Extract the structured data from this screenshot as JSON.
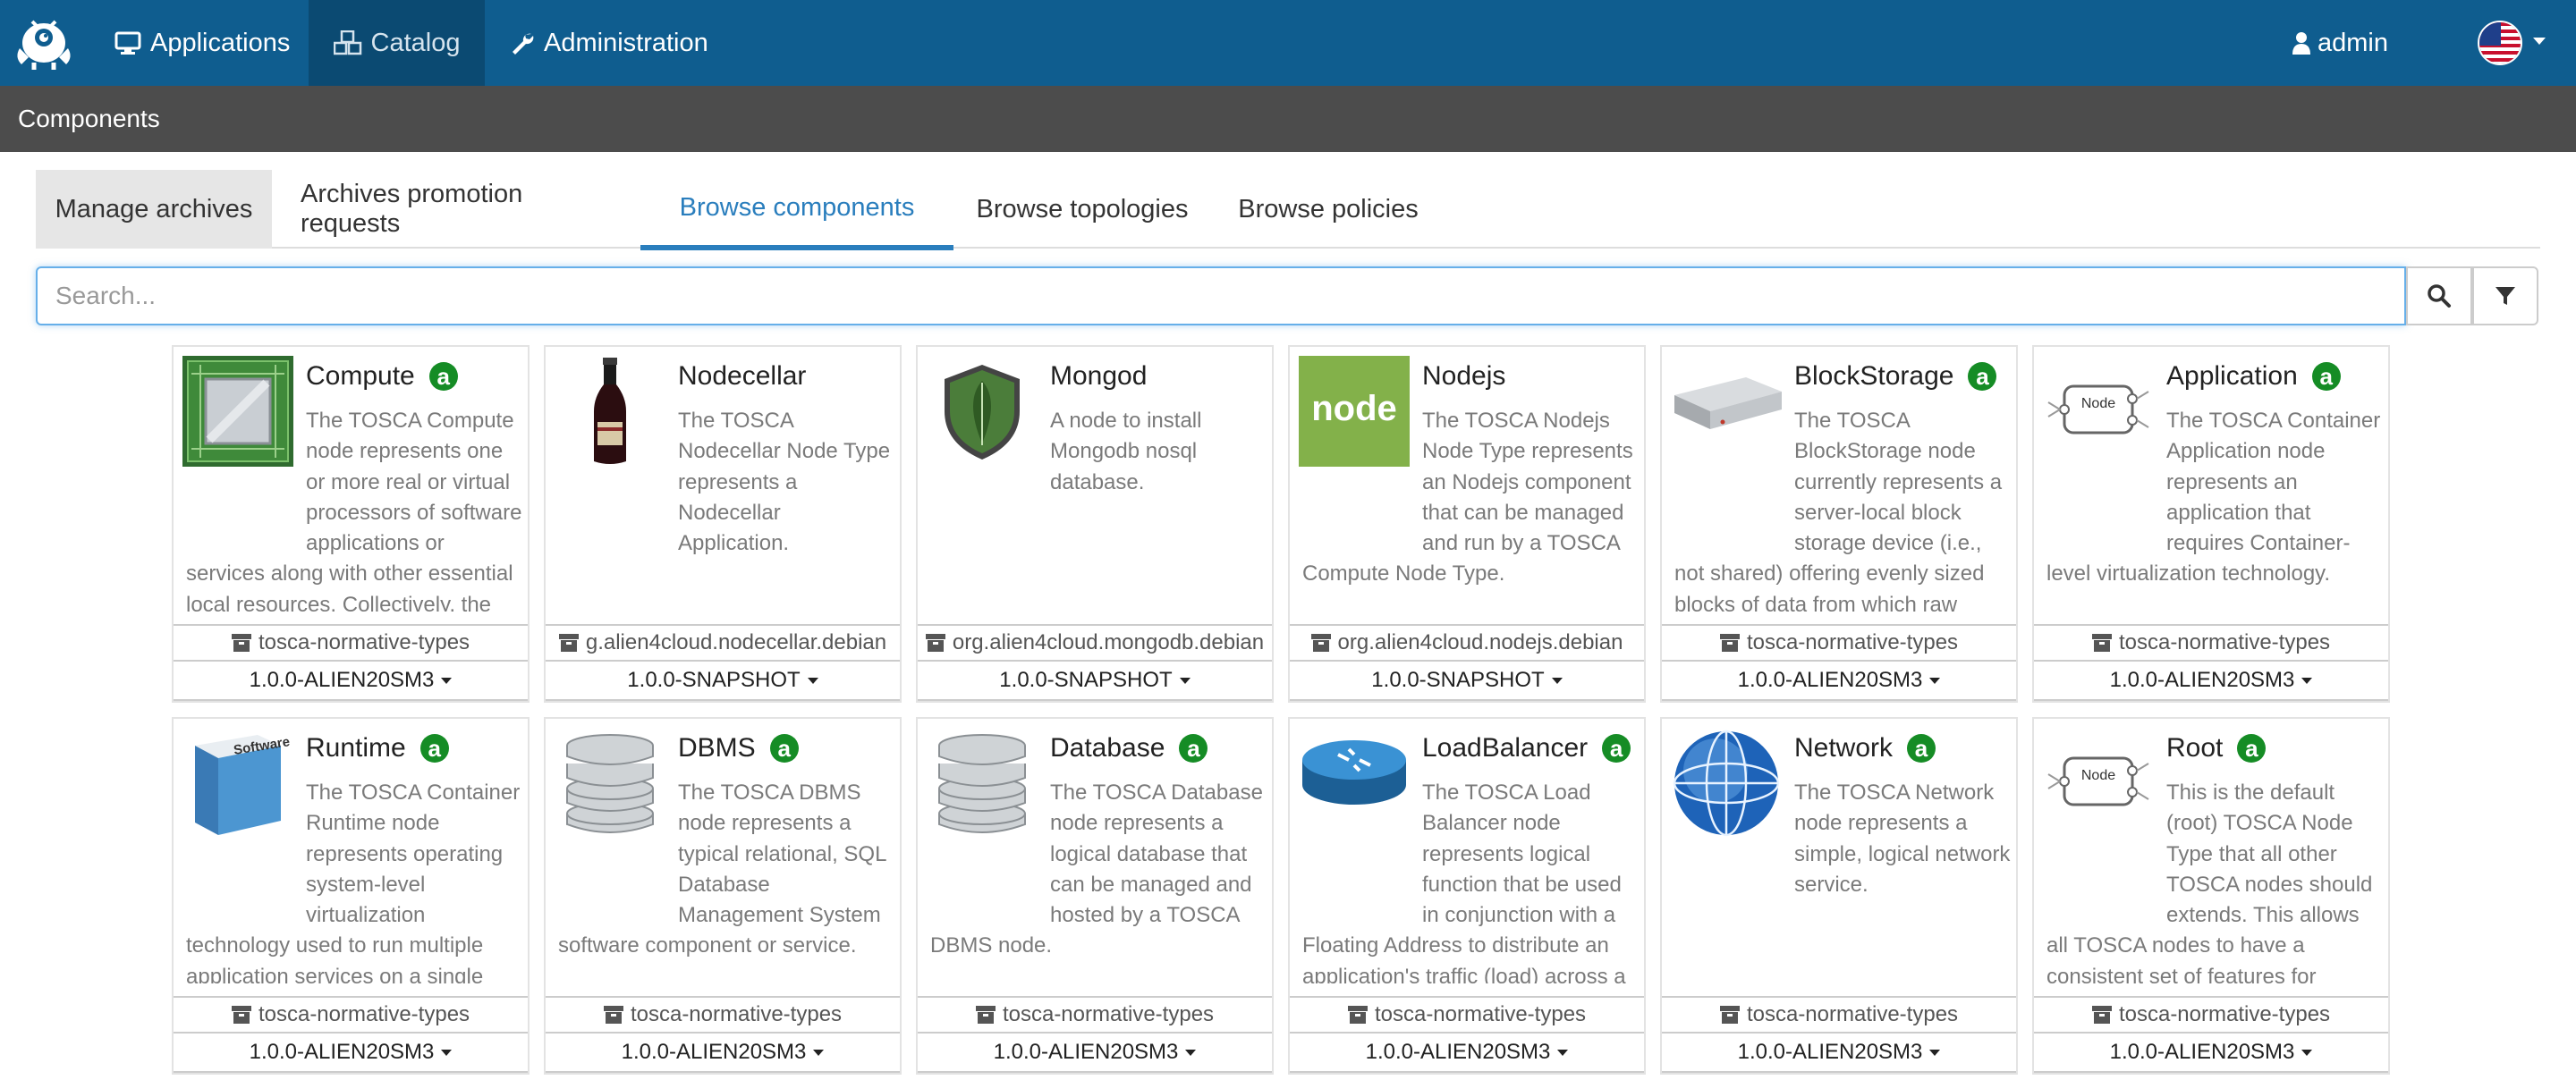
{
  "navbar": {
    "applications": "Applications",
    "catalog": "Catalog",
    "administration": "Administration",
    "user": "admin"
  },
  "subheader": {
    "title": "Components"
  },
  "tabs": [
    "Manage archives",
    "Archives promotion requests",
    "Browse components",
    "Browse topologies",
    "Browse policies"
  ],
  "active_tab": "Browse components",
  "search": {
    "placeholder": "Search..."
  },
  "colors": {
    "navbar": "#0f5d8f",
    "accent": "#2a7ebd",
    "badge": "#158c25",
    "subheader": "#4c4c4c"
  },
  "components": [
    {
      "name": "Compute",
      "badge": "a",
      "icon": "compute-chip-icon",
      "description": "The TOSCA Compute node represents one or more real or virtual processors of software applications or services along with other essential local resources. Collectively, the resources the",
      "archive": "tosca-normative-types",
      "version": "1.0.0-ALIEN20SM3"
    },
    {
      "name": "Nodecellar",
      "badge": "",
      "icon": "wine-bottle-icon",
      "description": "The TOSCA Nodecellar Node Type represents a Nodecellar Application.",
      "archive": "g.alien4cloud.nodecellar.debian",
      "version": "1.0.0-SNAPSHOT"
    },
    {
      "name": "Mongod",
      "badge": "",
      "icon": "mongodb-leaf-icon",
      "description": "A node to install Mongodb nosql database.",
      "archive": "org.alien4cloud.mongodb.debian",
      "version": "1.0.0-SNAPSHOT"
    },
    {
      "name": "Nodejs",
      "badge": "",
      "icon": "nodejs-logo-icon",
      "description": "The TOSCA Nodejs Node Type represents an Nodejs component that can be managed and run by a TOSCA Compute Node Type.",
      "archive": "org.alien4cloud.nodejs.debian",
      "version": "1.0.0-SNAPSHOT"
    },
    {
      "name": "BlockStorage",
      "badge": "a",
      "icon": "block-storage-icon",
      "description": "The TOSCA BlockStorage node currently represents a server-local block storage device (i.e., not shared) offering evenly sized blocks of data from which raw storage volumes can be",
      "archive": "tosca-normative-types",
      "version": "1.0.0-ALIEN20SM3"
    },
    {
      "name": "Application",
      "badge": "a",
      "icon": "node-diagram-icon",
      "description": "The TOSCA Container Application node represents an application that requires Container-level virtualization technology.",
      "archive": "tosca-normative-types",
      "version": "1.0.0-ALIEN20SM3"
    },
    {
      "name": "Runtime",
      "badge": "a",
      "icon": "software-box-icon",
      "description": "The TOSCA Container Runtime node represents operating system-level virtualization technology used to run multiple application services on a single Compute host.",
      "archive": "tosca-normative-types",
      "version": "1.0.0-ALIEN20SM3"
    },
    {
      "name": "DBMS",
      "badge": "a",
      "icon": "database-cylinder-icon",
      "description": "The TOSCA DBMS node represents a typical relational, SQL Database Management System software component or service.",
      "archive": "tosca-normative-types",
      "version": "1.0.0-ALIEN20SM3"
    },
    {
      "name": "Database",
      "badge": "a",
      "icon": "database-cylinder-icon",
      "description": "The TOSCA Database node represents a logical database that can be managed and hosted by a TOSCA DBMS node.",
      "archive": "tosca-normative-types",
      "version": "1.0.0-ALIEN20SM3"
    },
    {
      "name": "LoadBalancer",
      "badge": "a",
      "icon": "router-icon",
      "description": "The TOSCA Load Balancer node represents logical function that be used in conjunction with a Floating Address to distribute an application's traffic (load) across a",
      "archive": "tosca-normative-types",
      "version": "1.0.0-ALIEN20SM3"
    },
    {
      "name": "Network",
      "badge": "a",
      "icon": "globe-icon",
      "description": "The TOSCA Network node represents a simple, logical network service.",
      "archive": "tosca-normative-types",
      "version": "1.0.0-ALIEN20SM3"
    },
    {
      "name": "Root",
      "badge": "a",
      "icon": "node-diagram-icon",
      "description": "This is the default (root) TOSCA Node Type that all other TOSCA nodes should extends. This allows all TOSCA nodes to have a consistent set of features for modeling and management",
      "archive": "tosca-normative-types",
      "version": "1.0.0-ALIEN20SM3"
    }
  ]
}
